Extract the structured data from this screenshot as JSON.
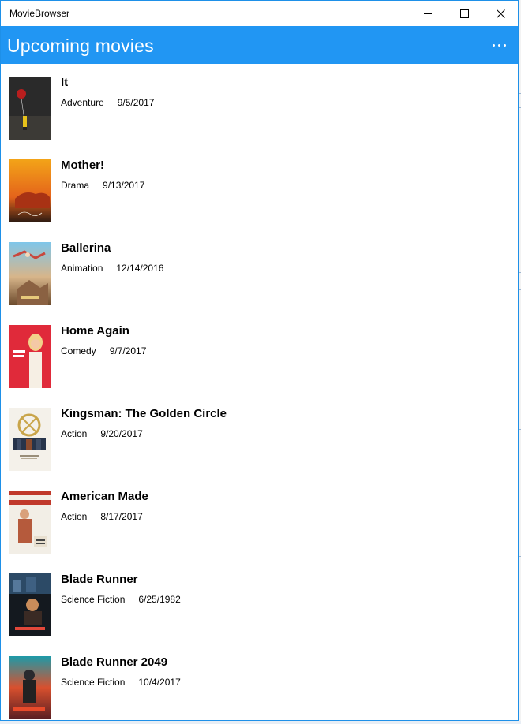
{
  "window": {
    "app_title": "MovieBrowser",
    "controls": {
      "minimize": "minimize-icon",
      "maximize": "maximize-icon",
      "close": "close-icon"
    }
  },
  "header": {
    "title": "Upcoming movies",
    "more_icon": "more-horizontal-icon",
    "accent_color": "#2196f3"
  },
  "movies": [
    {
      "title": "It",
      "genre": "Adventure",
      "date": "9/5/2017"
    },
    {
      "title": "Mother!",
      "genre": "Drama",
      "date": "9/13/2017"
    },
    {
      "title": "Ballerina",
      "genre": "Animation",
      "date": "12/14/2016"
    },
    {
      "title": "Home Again",
      "genre": "Comedy",
      "date": "9/7/2017"
    },
    {
      "title": "Kingsman: The Golden Circle",
      "genre": "Action",
      "date": "9/20/2017"
    },
    {
      "title": "American Made",
      "genre": "Action",
      "date": "8/17/2017"
    },
    {
      "title": "Blade Runner",
      "genre": "Science Fiction",
      "date": "6/25/1982"
    },
    {
      "title": "Blade Runner 2049",
      "genre": "Science Fiction",
      "date": "10/4/2017"
    }
  ]
}
